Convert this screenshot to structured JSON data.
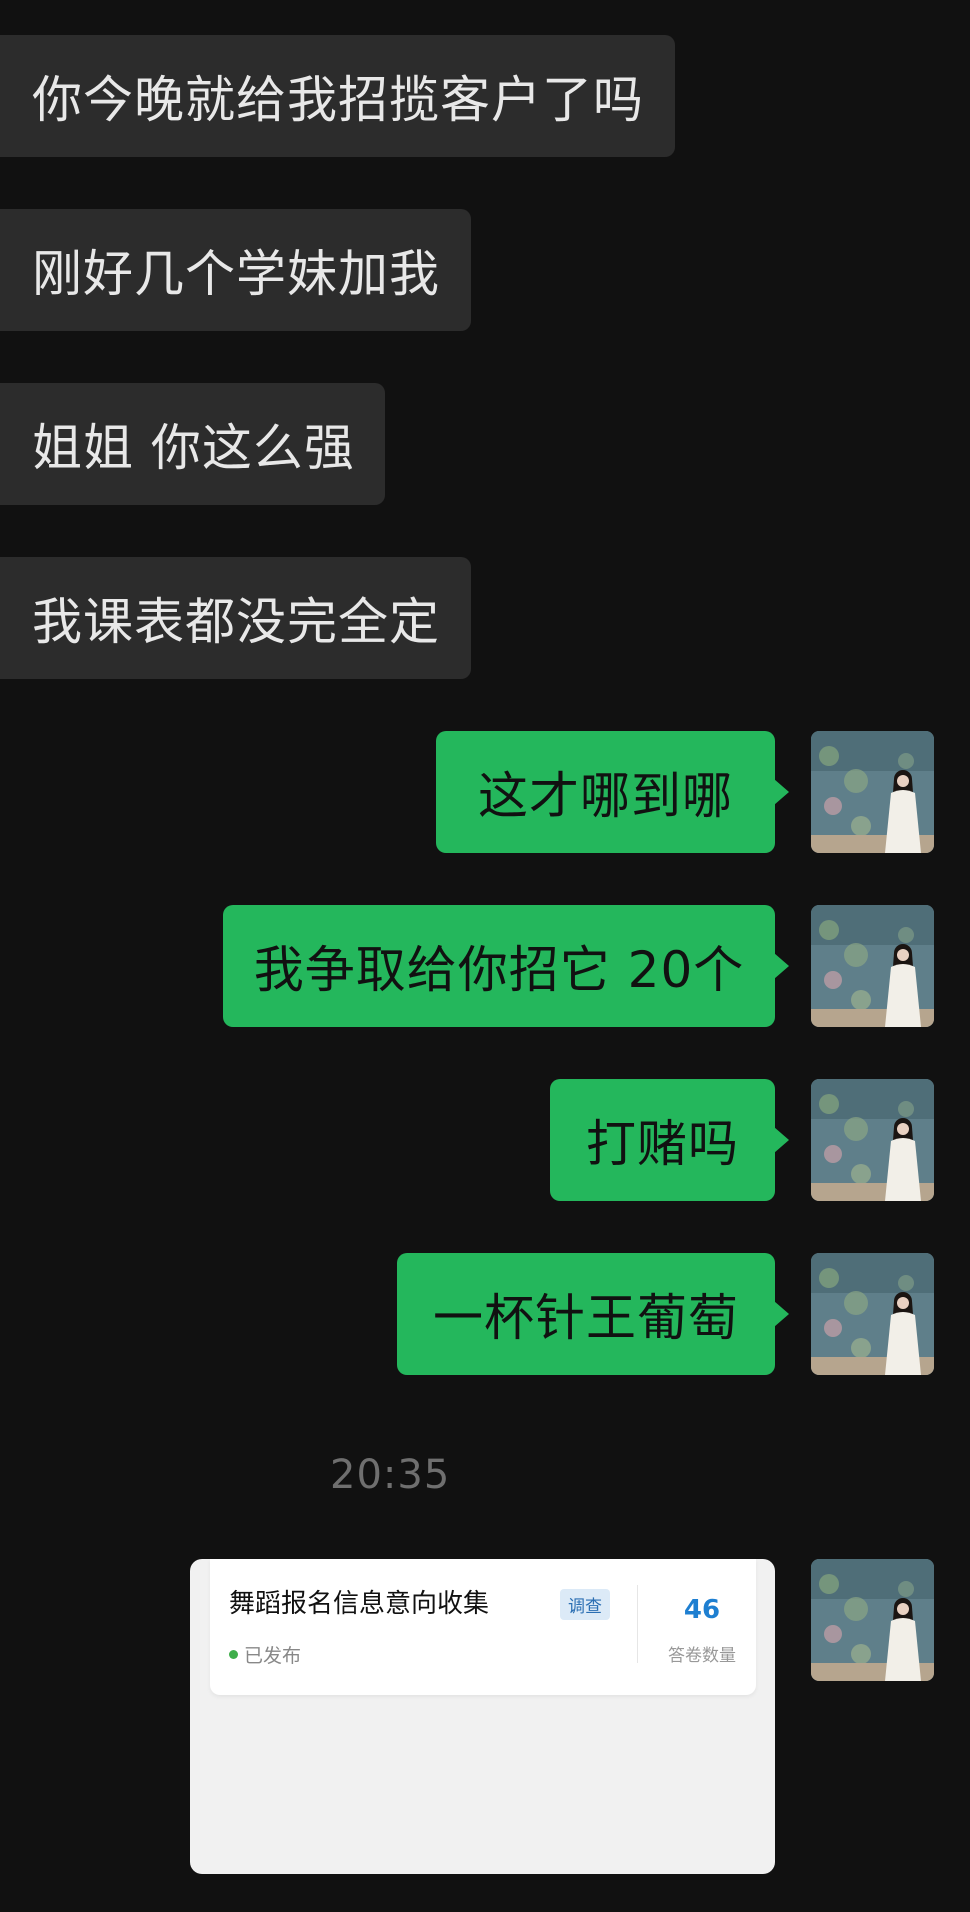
{
  "colors": {
    "background": "#111111",
    "incoming_bubble": "#2c2c2c",
    "outgoing_bubble": "#24b75c",
    "card_accent": "#1e7fd1"
  },
  "messages": [
    {
      "direction": "incoming",
      "text": "你今晚就给我招揽客户了吗"
    },
    {
      "direction": "incoming",
      "text": "刚好几个学妹加我"
    },
    {
      "direction": "incoming",
      "text": "姐姐 你这么强"
    },
    {
      "direction": "incoming",
      "text": "我课表都没完全定"
    },
    {
      "direction": "outgoing",
      "text": "这才哪到哪"
    },
    {
      "direction": "outgoing",
      "text": "我争取给你招它 20个"
    },
    {
      "direction": "outgoing",
      "text": "打赌吗"
    },
    {
      "direction": "outgoing",
      "text": "一杯针王葡萄"
    }
  ],
  "timestamp": "20:35",
  "shared_card": {
    "title": "舞蹈报名信息意向收集",
    "tag": "调查",
    "status": "已发布",
    "count": "46",
    "count_label": "答卷数量"
  },
  "avatar_icon": "user-avatar-icon"
}
